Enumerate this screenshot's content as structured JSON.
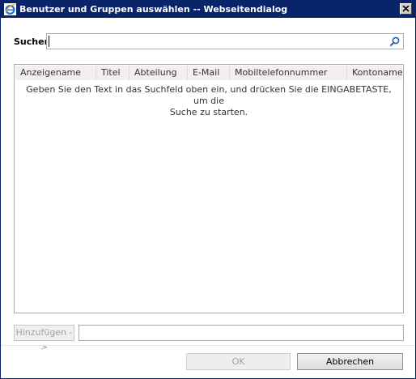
{
  "window": {
    "title": "Benutzer und Gruppen auswählen -- Webseitendialog",
    "close_glyph": "✕"
  },
  "search": {
    "label": "Suchen",
    "value": "",
    "placeholder": "",
    "icon": "search-icon"
  },
  "results": {
    "columns": [
      "Anzeigename",
      "Titel",
      "Abteilung",
      "E-Mail",
      "Mobiltelefonnummer",
      "Kontoname"
    ],
    "hint_line1": "Geben Sie den Text in das Suchfeld oben ein, und drücken Sie die EINGABETASTE, um die",
    "hint_line2": "Suche zu starten."
  },
  "add": {
    "button_label": "Hinzufügen ->",
    "field_value": ""
  },
  "footer": {
    "ok_label": "OK",
    "cancel_label": "Abbrechen"
  },
  "colors": {
    "titlebar": "#0a246a",
    "header_bg": "#f3eff1",
    "border": "#a5acb5"
  }
}
